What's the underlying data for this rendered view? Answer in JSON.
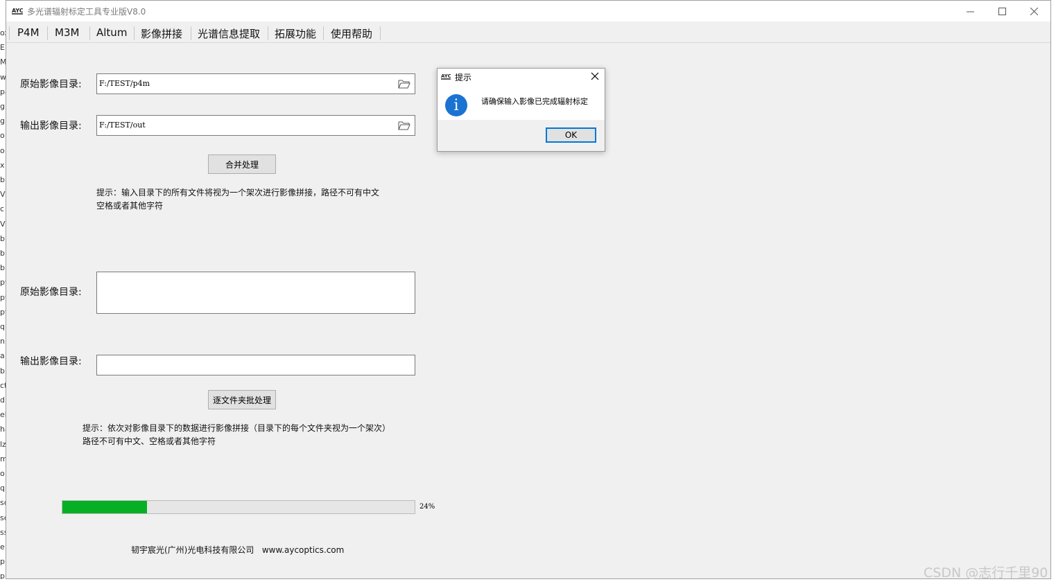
{
  "window": {
    "title": "多光谱辐射标定工具专业版V8.0",
    "icon_text": "AYC"
  },
  "menu": [
    {
      "label": "P4M"
    },
    {
      "label": "M3M"
    },
    {
      "label": "Altum"
    },
    {
      "label": "影像拼接"
    },
    {
      "label": "光谱信息提取"
    },
    {
      "label": "拓展功能"
    },
    {
      "label": "使用帮助"
    }
  ],
  "merge": {
    "input_label": "原始影像目录:",
    "input_value": "F:/TEST/p4m",
    "output_label": "输出影像目录:",
    "output_value": "F:/TEST/out",
    "button": "合并处理",
    "hint_line1": "提示：输入目录下的所有文件将视为一个架次进行影像拼接，路径不可有中文",
    "hint_line2": "空格或者其他字符"
  },
  "batch": {
    "input_label": "原始影像目录:",
    "input_value": "",
    "output_label": "输出影像目录:",
    "output_value": "",
    "button": "逐文件夹批处理",
    "hint_line1": "提示：依次对影像目录下的数据进行影像拼接（目录下的每个文件夹视为一个架次）",
    "hint_line2": "路径不可有中文、空格或者其他字符"
  },
  "progress": {
    "value": 24,
    "label": "24%",
    "color": "#06b025"
  },
  "footer": {
    "company": "韧宇宸光(广州)光电科技有限公司",
    "website": "www.aycoptics.com"
  },
  "dialog": {
    "title": "提示",
    "message": "请确保输入影像已完成辐射标定",
    "ok": "OK",
    "icon": "info-icon",
    "icon_glyph": "i"
  },
  "watermark": "CSDN @志行千里90",
  "background_window_text": [
    "ox",
    "E",
    "M",
    "w",
    "pa",
    "g",
    "g",
    "o",
    "o",
    "x",
    "b",
    "VC",
    "c",
    "VC",
    "b",
    "b",
    "b",
    "py",
    "py",
    "py",
    "q",
    "n",
    "a",
    "b",
    "ct",
    "d",
    "el",
    "ha",
    "lz",
    "m",
    "o",
    "q",
    "sc",
    "sc",
    "ss",
    "e",
    "p",
    "p"
  ]
}
